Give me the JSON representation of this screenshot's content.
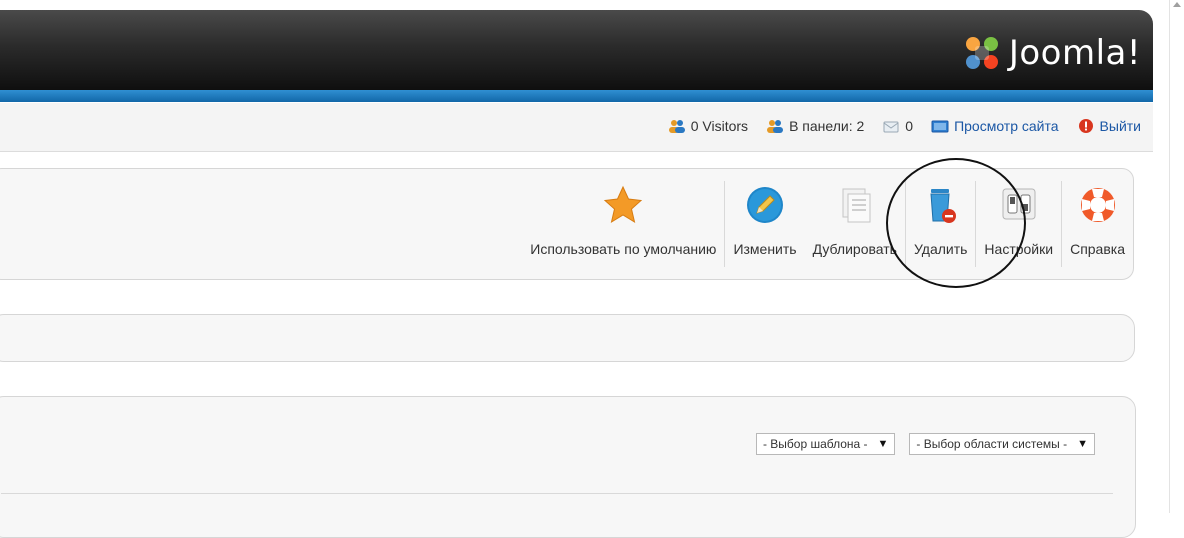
{
  "brand": {
    "name": "Joomla!"
  },
  "status_bar": {
    "visitors": "0 Visitors",
    "admins": "В панели: 2",
    "messages": "0",
    "view_site": "Просмотр сайта",
    "logout": "Выйти"
  },
  "toolbar": {
    "buttons": [
      {
        "label": "Использовать по умолчанию",
        "icon": "star-icon"
      },
      {
        "label": "Изменить",
        "icon": "edit-pencil-icon"
      },
      {
        "label": "Дублировать",
        "icon": "copy-icon"
      },
      {
        "label": "Удалить",
        "icon": "trash-icon"
      },
      {
        "label": "Настройки",
        "icon": "options-switch-icon"
      },
      {
        "label": "Справка",
        "icon": "lifebuoy-icon"
      }
    ]
  },
  "filters": {
    "template_select": "- Выбор шаблона -",
    "client_select": "- Выбор области системы -"
  },
  "colors": {
    "header_dark": "#1a1a1a",
    "accent_blue": "#1b6fb5",
    "link_blue": "#1b57a5",
    "logout_red": "#d8361f"
  }
}
